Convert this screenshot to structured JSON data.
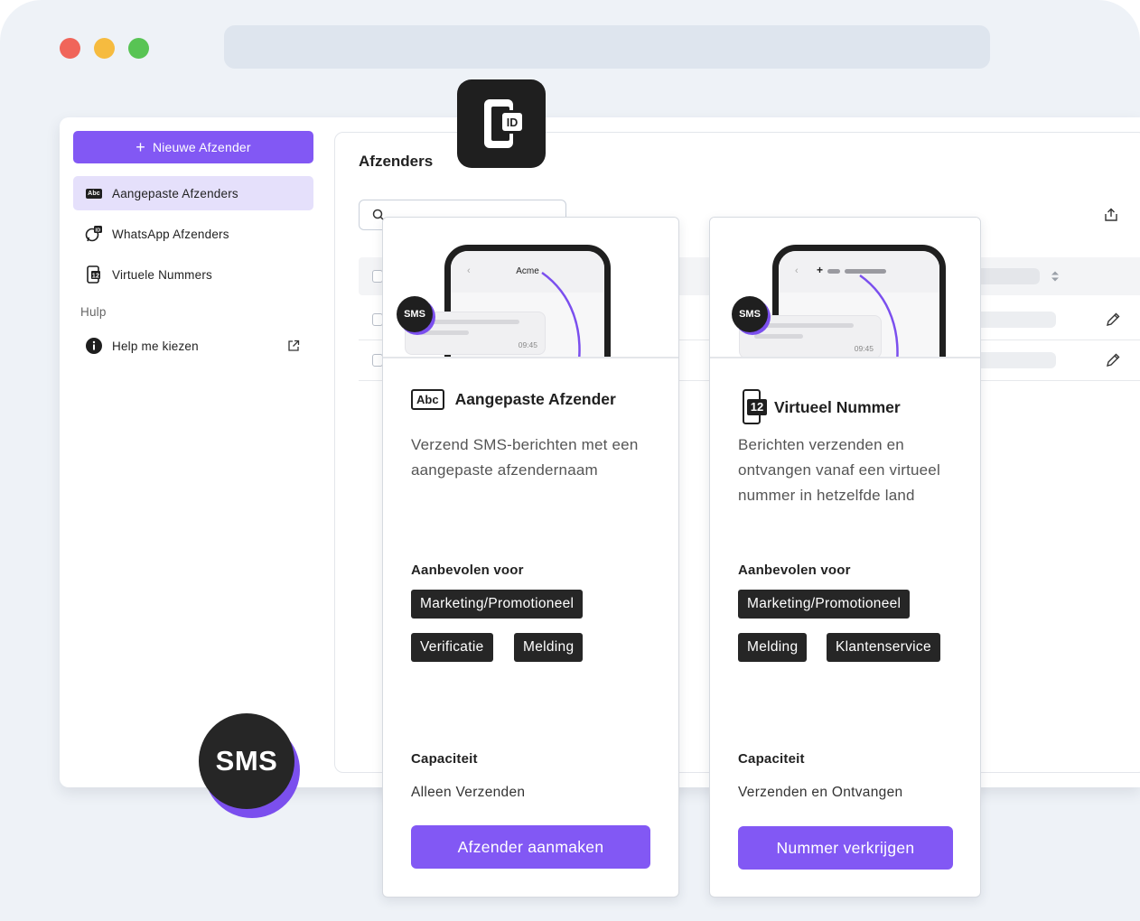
{
  "sidebar": {
    "new_button": "Nieuwe Afzender",
    "items": [
      {
        "label": "Aangepaste Afzenders",
        "icon": "abc-icon"
      },
      {
        "label": "WhatsApp Afzenders",
        "icon": "whatsapp-id-icon"
      },
      {
        "label": "Virtuele Nummers",
        "icon": "virtual-number-icon"
      }
    ],
    "help_heading": "Hulp",
    "help_item": "Help me kiezen"
  },
  "main": {
    "title": "Afzenders",
    "search_placeholder": ""
  },
  "cards": [
    {
      "phone_title": "Acme",
      "phone_time": "09:45",
      "sms_badge": "SMS",
      "icon_text": "Abc",
      "title": "Aangepaste Afzender",
      "description": "Verzend SMS-berichten met een aangepaste afzendernaam",
      "recommended_heading": "Aanbevolen voor",
      "tags": [
        "Marketing/Promotioneel",
        "Verificatie",
        "Melding"
      ],
      "capacity_heading": "Capaciteit",
      "capacity_value": "Alleen Verzenden",
      "cta": "Afzender aanmaken"
    },
    {
      "phone_time": "09:45",
      "sms_badge": "SMS",
      "icon_text": "12",
      "title": "Virtueel Nummer",
      "description": "Berichten verzenden en ontvangen vanaf een virtueel nummer in hetzelfde land",
      "recommended_heading": "Aanbevolen voor",
      "tags": [
        "Marketing/Promotioneel",
        "Melding",
        "Klantenservice"
      ],
      "capacity_heading": "Capaciteit",
      "capacity_value": "Verzenden en Ontvangen",
      "cta": "Nummer verkrijgen"
    }
  ],
  "big_badge": "SMS",
  "colors": {
    "accent": "#8258f4",
    "accent_soft": "#e5e0fb",
    "dark": "#1f1f1f",
    "window_red": "#f0655a",
    "window_yellow": "#f6bb3f",
    "window_green": "#58c454"
  }
}
